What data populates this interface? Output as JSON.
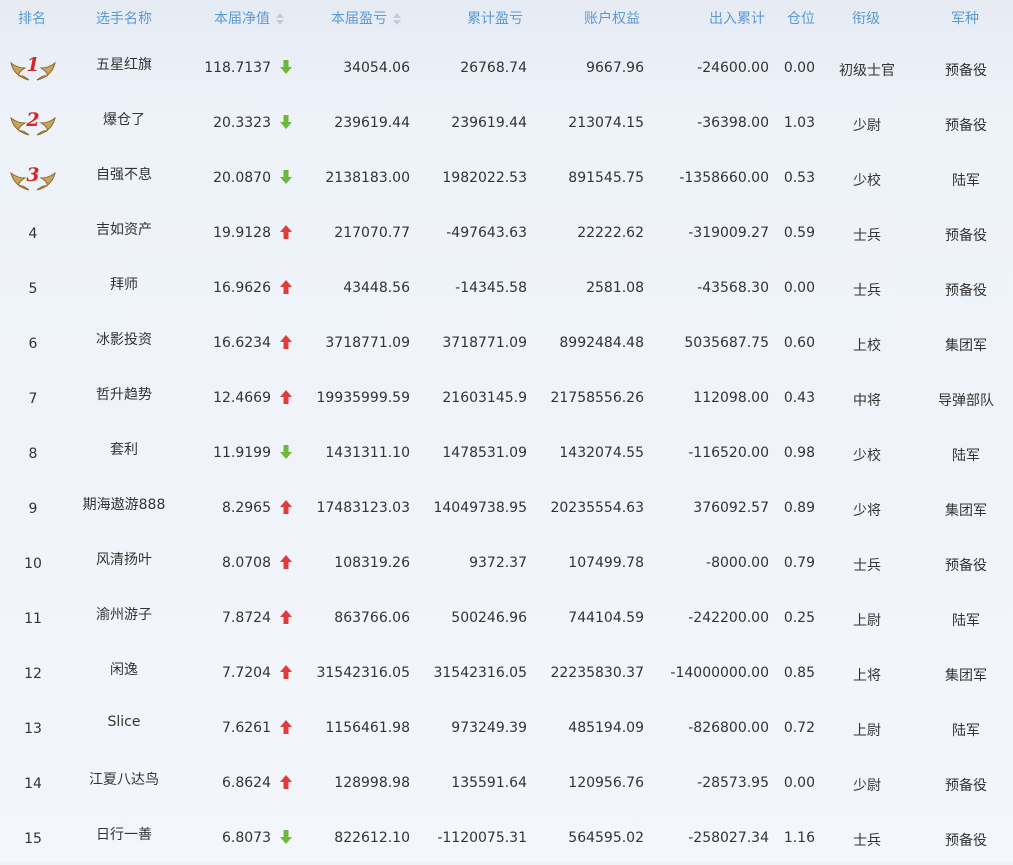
{
  "columns": {
    "rank": "排名",
    "name": "选手名称",
    "nav": "本届净值",
    "pnl": "本届盈亏",
    "cum_pnl": "累计盈亏",
    "equity": "账户权益",
    "net_flow": "出入累计",
    "position": "仓位",
    "grade": "衔级",
    "arm": "军种"
  },
  "colors": {
    "header_text": "#5b9bd5",
    "arrow_up": "#e03c3c",
    "arrow_down": "#6cb83a",
    "medal_number": "#d42626",
    "medal_wing": "#c9a45c"
  },
  "rows": [
    {
      "rank": "1",
      "name": "五星红旗",
      "nav": "118.7137",
      "trend": "down",
      "pnl": "34054.06",
      "cum_pnl": "26768.74",
      "equity": "9667.96",
      "net_flow": "-24600.00",
      "position": "0.00",
      "grade": "初级士官",
      "arm": "预备役",
      "medal": "gold-wings"
    },
    {
      "rank": "2",
      "name": "爆仓了",
      "nav": "20.3323",
      "trend": "down",
      "pnl": "239619.44",
      "cum_pnl": "239619.44",
      "equity": "213074.15",
      "net_flow": "-36398.00",
      "position": "1.03",
      "grade": "少尉",
      "arm": "预备役",
      "medal": "gold-wings"
    },
    {
      "rank": "3",
      "name": "自强不息",
      "nav": "20.0870",
      "trend": "down",
      "pnl": "2138183.00",
      "cum_pnl": "1982022.53",
      "equity": "891545.75",
      "net_flow": "-1358660.00",
      "position": "0.53",
      "grade": "少校",
      "arm": "陆军",
      "medal": "gold-wings"
    },
    {
      "rank": "4",
      "name": "吉如资产",
      "nav": "19.9128",
      "trend": "up",
      "pnl": "217070.77",
      "cum_pnl": "-497643.63",
      "equity": "22222.62",
      "net_flow": "-319009.27",
      "position": "0.59",
      "grade": "士兵",
      "arm": "预备役"
    },
    {
      "rank": "5",
      "name": "拜师",
      "nav": "16.9626",
      "trend": "up",
      "pnl": "43448.56",
      "cum_pnl": "-14345.58",
      "equity": "2581.08",
      "net_flow": "-43568.30",
      "position": "0.00",
      "grade": "士兵",
      "arm": "预备役"
    },
    {
      "rank": "6",
      "name": "冰影投资",
      "nav": "16.6234",
      "trend": "up",
      "pnl": "3718771.09",
      "cum_pnl": "3718771.09",
      "equity": "8992484.48",
      "net_flow": "5035687.75",
      "position": "0.60",
      "grade": "上校",
      "arm": "集团军"
    },
    {
      "rank": "7",
      "name": "哲升趋势",
      "nav": "12.4669",
      "trend": "up",
      "pnl": "19935999.59",
      "cum_pnl": "21603145.9",
      "equity": "21758556.26",
      "net_flow": "112098.00",
      "position": "0.43",
      "grade": "中将",
      "arm": "导弹部队"
    },
    {
      "rank": "8",
      "name": "套利",
      "nav": "11.9199",
      "trend": "down",
      "pnl": "1431311.10",
      "cum_pnl": "1478531.09",
      "equity": "1432074.55",
      "net_flow": "-116520.00",
      "position": "0.98",
      "grade": "少校",
      "arm": "陆军"
    },
    {
      "rank": "9",
      "name": "期海遨游888",
      "nav": "8.2965",
      "trend": "up",
      "pnl": "17483123.03",
      "cum_pnl": "14049738.95",
      "equity": "20235554.63",
      "net_flow": "376092.57",
      "position": "0.89",
      "grade": "少将",
      "arm": "集团军"
    },
    {
      "rank": "10",
      "name": "风清扬叶",
      "nav": "8.0708",
      "trend": "up",
      "pnl": "108319.26",
      "cum_pnl": "9372.37",
      "equity": "107499.78",
      "net_flow": "-8000.00",
      "position": "0.79",
      "grade": "士兵",
      "arm": "预备役"
    },
    {
      "rank": "11",
      "name": "渝州游子",
      "nav": "7.8724",
      "trend": "up",
      "pnl": "863766.06",
      "cum_pnl": "500246.96",
      "equity": "744104.59",
      "net_flow": "-242200.00",
      "position": "0.25",
      "grade": "上尉",
      "arm": "陆军"
    },
    {
      "rank": "12",
      "name": "闲逸",
      "nav": "7.7204",
      "trend": "up",
      "pnl": "31542316.05",
      "cum_pnl": "31542316.05",
      "equity": "22235830.37",
      "net_flow": "-14000000.00",
      "position": "0.85",
      "grade": "上将",
      "arm": "集团军"
    },
    {
      "rank": "13",
      "name": "Slice",
      "nav": "7.6261",
      "trend": "up",
      "pnl": "1156461.98",
      "cum_pnl": "973249.39",
      "equity": "485194.09",
      "net_flow": "-826800.00",
      "position": "0.72",
      "grade": "上尉",
      "arm": "陆军"
    },
    {
      "rank": "14",
      "name": "江夏八达鸟",
      "nav": "6.8624",
      "trend": "up",
      "pnl": "128998.98",
      "cum_pnl": "135591.64",
      "equity": "120956.76",
      "net_flow": "-28573.95",
      "position": "0.00",
      "grade": "少尉",
      "arm": "预备役"
    },
    {
      "rank": "15",
      "name": "日行一善",
      "nav": "6.8073",
      "trend": "down",
      "pnl": "822612.10",
      "cum_pnl": "-1120075.31",
      "equity": "564595.02",
      "net_flow": "-258027.34",
      "position": "1.16",
      "grade": "士兵",
      "arm": "预备役"
    }
  ]
}
